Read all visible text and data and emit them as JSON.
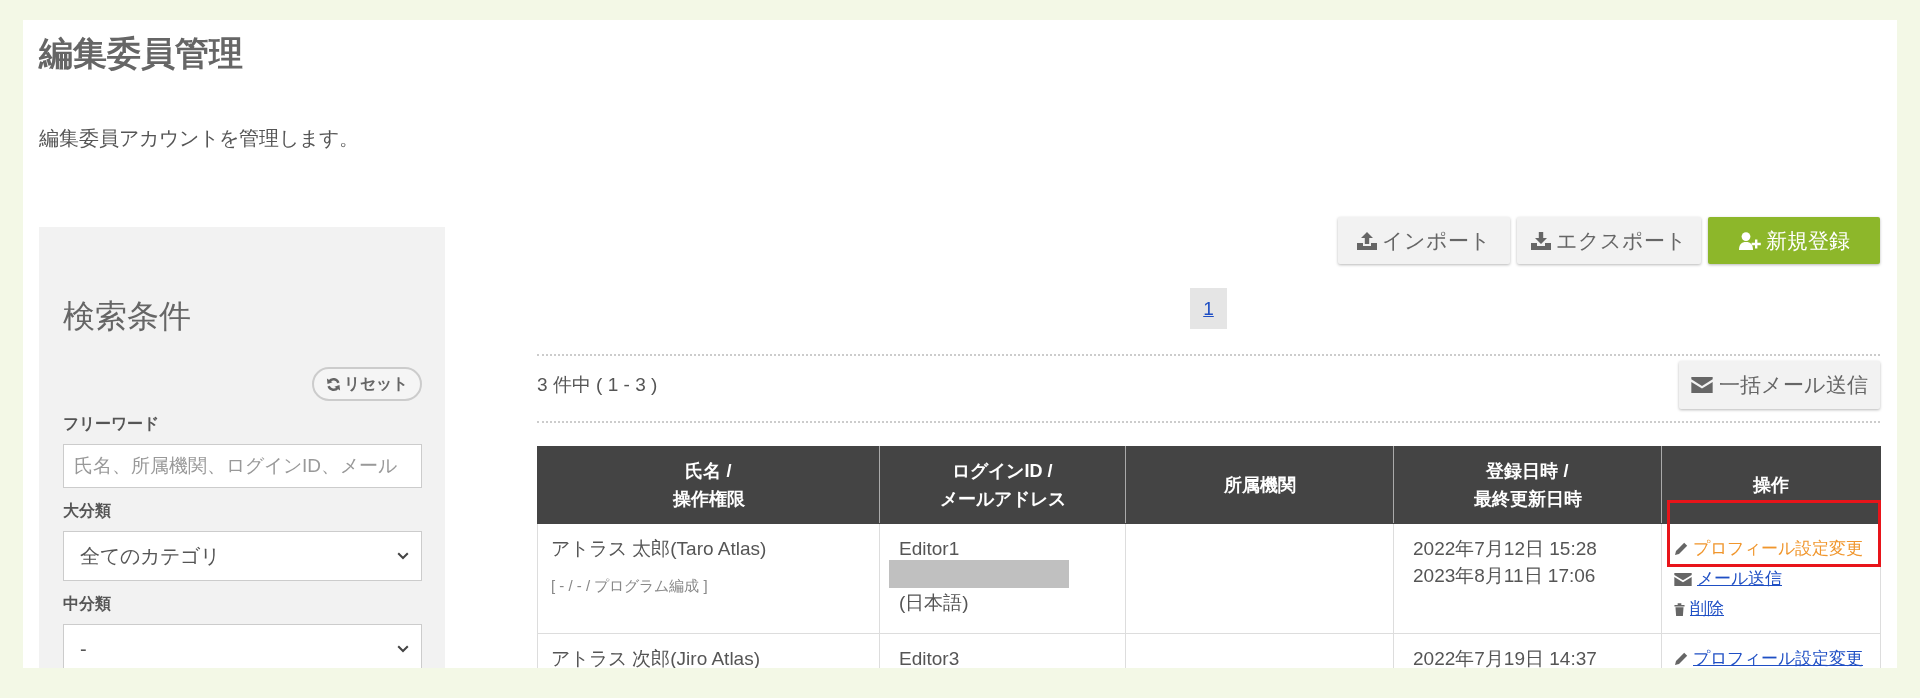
{
  "page": {
    "title": "編集委員管理",
    "description": "編集委員アカウントを管理します。"
  },
  "search_panel": {
    "title": "検索条件",
    "reset_button": "リセット",
    "fields": [
      {
        "kind": "text",
        "label": "フリーワード",
        "placeholder": "氏名、所属機関、ログインID、メール"
      },
      {
        "kind": "select",
        "label": "大分類",
        "value": "全てのカテゴリ"
      },
      {
        "kind": "select",
        "label": "中分類",
        "value": "-"
      }
    ]
  },
  "toolbar": [
    {
      "kind": "import",
      "label": "インポート",
      "primary": false
    },
    {
      "kind": "export",
      "label": "エクスポート",
      "primary": false
    },
    {
      "kind": "new",
      "label": "新規登録",
      "primary": true
    }
  ],
  "pagination": [
    {
      "label": "1",
      "selected": true
    }
  ],
  "result_count": "3 件中 ( 1 - 3 )",
  "bulk_mail_button": "一括メール送信",
  "table": {
    "columns": [
      {
        "lines": [
          "氏名 /",
          "操作権限"
        ]
      },
      {
        "lines": [
          "ログインID /",
          "メールアドレス"
        ]
      },
      {
        "lines": [
          "所属機関"
        ]
      },
      {
        "lines": [
          "登録日時 /",
          "最終更新日時"
        ]
      },
      {
        "lines": [
          "操作"
        ]
      }
    ],
    "rows": [
      {
        "name": "アトラス 太郎(Taro Atlas)",
        "permissions": "[ - / - / プログラム編成 ]",
        "login_id": "Editor1",
        "email_redacted": true,
        "language": "(日本語)",
        "registered": "2022年7月12日 15:28",
        "updated": "2023年8月11日 17:06",
        "actions": [
          {
            "kind": "edit",
            "label": "プロフィール設定変更",
            "hovered": true,
            "highlighted": true
          },
          {
            "kind": "mail",
            "label": "メール送信",
            "hovered": false,
            "highlighted": false
          },
          {
            "kind": "delete",
            "label": "削除",
            "hovered": false,
            "highlighted": false
          }
        ]
      },
      {
        "name": "アトラス 次郎(Jiro Atlas)",
        "login_id": "Editor3",
        "registered": "2022年7月19日 14:37",
        "actions": [
          {
            "kind": "edit",
            "label": "プロフィール設定変更",
            "hovered": false,
            "highlighted": false
          }
        ]
      }
    ]
  }
}
